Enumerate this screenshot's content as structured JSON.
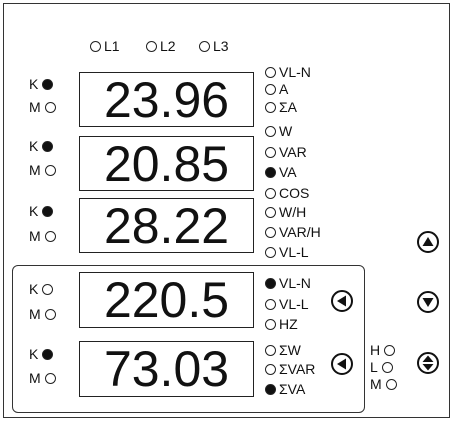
{
  "phase_leds": [
    {
      "label": "L1",
      "on": false
    },
    {
      "label": "L2",
      "on": false
    },
    {
      "label": "L3",
      "on": false
    }
  ],
  "displays": [
    {
      "value": "23.96",
      "k_on": true,
      "m_on": false
    },
    {
      "value": "20.85",
      "k_on": true,
      "m_on": false
    },
    {
      "value": "28.22",
      "k_on": true,
      "m_on": false
    },
    {
      "value": "220.5",
      "k_on": false,
      "m_on": false
    },
    {
      "value": "73.03",
      "k_on": true,
      "m_on": false
    }
  ],
  "k_label": "K",
  "m_label": "M",
  "upper_units": [
    {
      "label": "VL-N",
      "on": false
    },
    {
      "label": "A",
      "on": false
    },
    {
      "label": "ΣA",
      "on": false
    },
    {
      "label": "W",
      "on": false
    },
    {
      "label": "VAR",
      "on": false
    },
    {
      "label": "VA",
      "on": true
    },
    {
      "label": "COS",
      "on": false
    },
    {
      "label": "W/H",
      "on": false
    },
    {
      "label": "VAR/H",
      "on": false
    },
    {
      "label": "VL-L",
      "on": false
    }
  ],
  "lower_units": [
    {
      "label": "VL-N",
      "on": true
    },
    {
      "label": "VL-L",
      "on": false
    },
    {
      "label": "HZ",
      "on": false
    },
    {
      "label": "ΣW",
      "on": false
    },
    {
      "label": "ΣVAR",
      "on": false
    },
    {
      "label": "ΣVA",
      "on": true
    }
  ],
  "hlm": [
    {
      "label": "H",
      "on": false
    },
    {
      "label": "L",
      "on": false
    },
    {
      "label": "M",
      "on": false
    }
  ],
  "buttons": {
    "up": "up-arrow",
    "down": "down-arrow",
    "updown": "up-down-arrow",
    "left1": "left-arrow",
    "left2": "left-arrow"
  }
}
